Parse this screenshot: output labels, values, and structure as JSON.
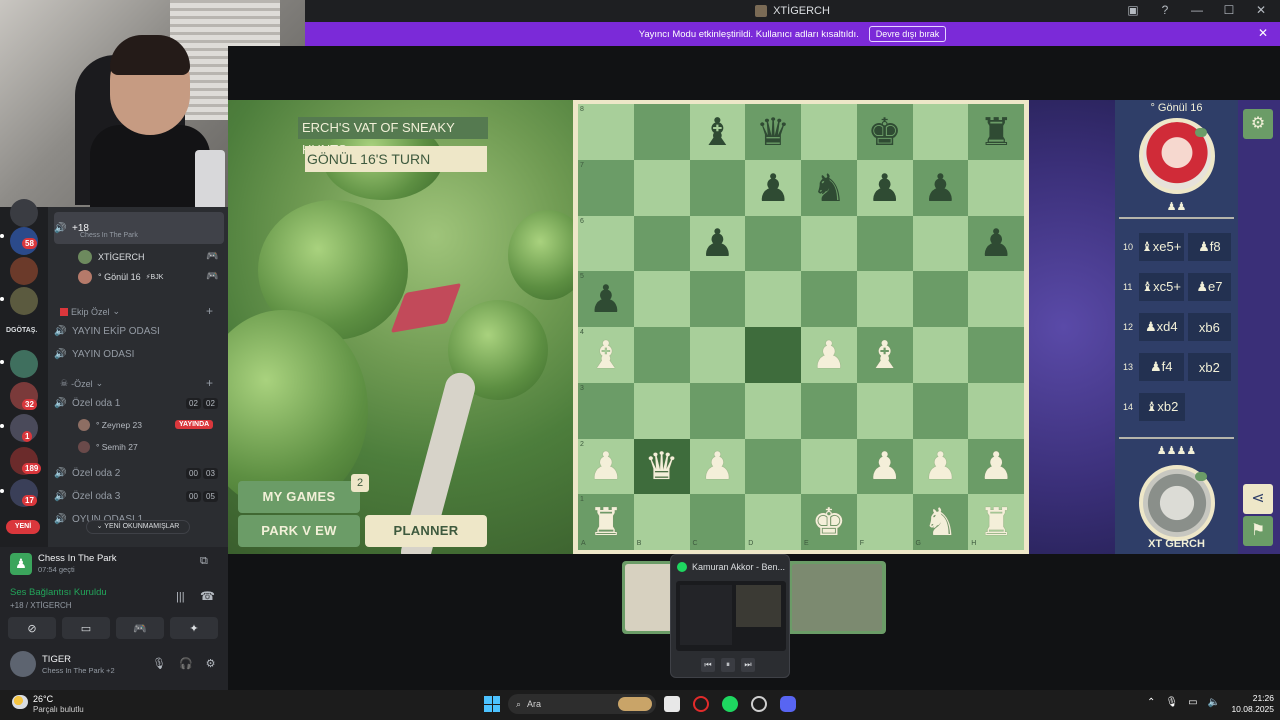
{
  "window": {
    "title": "XTİGERCH"
  },
  "streamer_banner": {
    "message": "Yayıncı Modu etkinleştirildi. Kullanıcı adları kısaltıldı.",
    "button": "Devre dışı bırak"
  },
  "rail": {
    "badges": [
      "58",
      "32",
      "1",
      "189",
      "17"
    ],
    "label": "DGÖTAŞ.",
    "new_pill": "YENİ"
  },
  "sidebar": {
    "selected_channel": {
      "name": "+18",
      "status": "Chess In The Park"
    },
    "members": [
      {
        "name": "XTİGERCH"
      },
      {
        "name": "° Gönül 16",
        "tag": "⚡BJK"
      }
    ],
    "category_team": "Ekip Özel",
    "team_channels": [
      "YAYIN EKİP ODASI",
      "YAYIN ODASI"
    ],
    "category_private": "-Özel",
    "private_rooms": [
      {
        "name": "Özel oda 1",
        "a": "02",
        "b": "02"
      },
      {
        "name": "Özel oda 2",
        "a": "00",
        "b": "03"
      },
      {
        "name": "Özel oda 3",
        "a": "00",
        "b": "05"
      },
      {
        "name": "OYUN ODASI 1"
      }
    ],
    "room1_users": [
      {
        "name": "° Zeynep 23",
        "live": "YAYINDA"
      },
      {
        "name": "° Semih 27"
      }
    ],
    "unread_pill": "YENİ OKUNMAMIŞLAR"
  },
  "activity": {
    "app_name": "Chess In The Park",
    "elapsed": "07:54 geçti",
    "voice_status": "Ses Bağlantısı Kuruldu",
    "voice_channel": "+18 / XTİGERCH",
    "user_name": "TIGER",
    "user_status": "Chess In The Park +2"
  },
  "game": {
    "title": "ERCH'S VAT OF SNEAKY HUNTS",
    "turn": "GÖNÜL 16'S TURN",
    "buttons": {
      "my_games": "MY GAMES",
      "games_count": "2",
      "park_view": "PARK V EW",
      "planner": "PLANNER"
    },
    "opponent_name": "° Gönül 16",
    "opponent_captures": "♟♟",
    "my_captures": "♟♟♟♟",
    "my_name": "XT GERCH",
    "moves": [
      {
        "no": "10",
        "w": "♝xe5+",
        "b": "♟f8"
      },
      {
        "no": "11",
        "w": "♝xc5+",
        "b": "♟e7"
      },
      {
        "no": "12",
        "w": "♟xd4",
        "b": "xb6"
      },
      {
        "no": "13",
        "w": "♟f4",
        "b": "xb2"
      },
      {
        "no": "14",
        "w": "♝xb2",
        "b": ""
      }
    ],
    "board": {
      "files": [
        "A",
        "B",
        "C",
        "D",
        "E",
        "F",
        "G",
        "H"
      ],
      "ranks": [
        "8",
        "7",
        "6",
        "5",
        "4",
        "3",
        "2",
        "1"
      ],
      "pieces": [
        {
          "sq": "c8",
          "p": "♝",
          "c": "b"
        },
        {
          "sq": "d8",
          "p": "♛",
          "c": "b"
        },
        {
          "sq": "f8",
          "p": "♚",
          "c": "b"
        },
        {
          "sq": "h8",
          "p": "♜",
          "c": "b"
        },
        {
          "sq": "d7",
          "p": "♟",
          "c": "b"
        },
        {
          "sq": "e7",
          "p": "♞",
          "c": "b"
        },
        {
          "sq": "f7",
          "p": "♟",
          "c": "b"
        },
        {
          "sq": "g7",
          "p": "♟",
          "c": "b"
        },
        {
          "sq": "c6",
          "p": "♟",
          "c": "b"
        },
        {
          "sq": "h6",
          "p": "♟",
          "c": "b"
        },
        {
          "sq": "a5",
          "p": "♟",
          "c": "b"
        },
        {
          "sq": "a4",
          "p": "♝",
          "c": "w"
        },
        {
          "sq": "e4",
          "p": "♟",
          "c": "w"
        },
        {
          "sq": "f4",
          "p": "♝",
          "c": "w"
        },
        {
          "sq": "a2",
          "p": "♟",
          "c": "w"
        },
        {
          "sq": "b2",
          "p": "♛",
          "c": "w"
        },
        {
          "sq": "c2",
          "p": "♟",
          "c": "w"
        },
        {
          "sq": "f2",
          "p": "♟",
          "c": "w"
        },
        {
          "sq": "g2",
          "p": "♟",
          "c": "w"
        },
        {
          "sq": "h2",
          "p": "♟",
          "c": "w"
        },
        {
          "sq": "a1",
          "p": "♜",
          "c": "w"
        },
        {
          "sq": "e1",
          "p": "♚",
          "c": "w"
        },
        {
          "sq": "g1",
          "p": "♞",
          "c": "w"
        },
        {
          "sq": "h1",
          "p": "♜",
          "c": "w"
        }
      ],
      "highlight": [
        "d4",
        "b2"
      ]
    }
  },
  "media_popup": {
    "track": "Kamuran Akkor - Ben..."
  },
  "taskbar": {
    "temp": "26°C",
    "weather": "Parçalı bulutlu",
    "search_placeholder": "Ara",
    "time": "21:26",
    "date": "10.08.2025"
  }
}
